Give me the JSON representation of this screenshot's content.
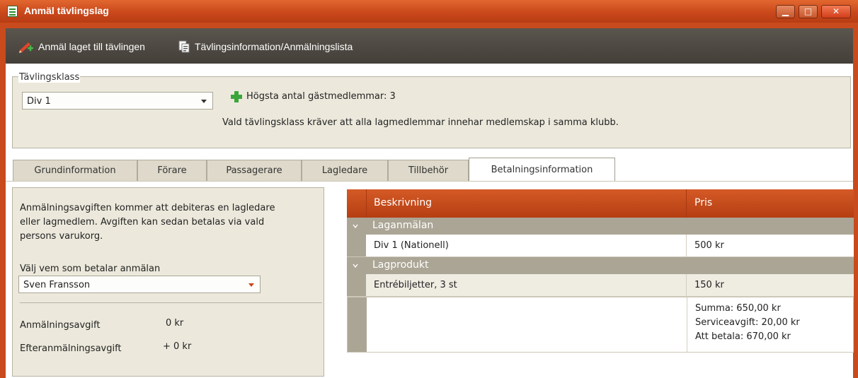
{
  "window": {
    "title": "Anmäl tävlingslag",
    "buttons": {
      "minimize": "▁",
      "maximize": "□",
      "close": "✕"
    }
  },
  "toolbar": {
    "register_label": "Anmäl laget till tävlingen",
    "info_label": "Tävlingsinformation/Anmälningslista"
  },
  "competition_class": {
    "group_label": "Tävlingsklass",
    "selected": "Div 1",
    "max_guests": "Högsta antal gästmedlemmar: 3",
    "requirement_note": "Vald tävlingsklass kräver att alla lagmedlemmar innehar medlemskap i samma klubb."
  },
  "tabs": [
    {
      "label": "Grundinformation"
    },
    {
      "label": "Förare"
    },
    {
      "label": "Passagerare"
    },
    {
      "label": "Lagledare"
    },
    {
      "label": "Tillbehör"
    },
    {
      "label": "Betalningsinformation",
      "active": true
    }
  ],
  "payment": {
    "info_line1": "Anmälningsavgiften kommer att debiteras en lagledare",
    "info_line2": "eller lagmedlem. Avgiften kan sedan betalas via vald",
    "info_line3": "persons varukorg.",
    "payer_label": "Välj vem som betalar anmälan",
    "payer_selected": "Sven Fransson",
    "fee_label": "Anmälningsavgift",
    "fee_value": "0 kr",
    "late_fee_label": "Efteranmälningsavgift",
    "late_fee_value": "+ 0 kr"
  },
  "price_table": {
    "columns": [
      "Beskrivning",
      "Pris"
    ],
    "groups": [
      {
        "name": "Laganmälan",
        "rows": [
          {
            "description": "Div 1 (Nationell)",
            "price": "500 kr"
          }
        ]
      },
      {
        "name": "Lagprodukt",
        "rows": [
          {
            "description": "Entrébiljetter, 3 st",
            "price": "150 kr"
          }
        ]
      }
    ],
    "summary": {
      "total": "Summa: 650,00 kr",
      "service_fee": "Serviceavgift: 20,00 kr",
      "to_pay": "Att betala: 670,00 kr"
    }
  },
  "colors": {
    "title_bar": "#c8461a",
    "toolbar": "#4a463f",
    "panel_bg": "#ece9dc",
    "table_header": "#c44a1a",
    "group_row": "#aba595",
    "add_icon": "#3aa63a"
  }
}
